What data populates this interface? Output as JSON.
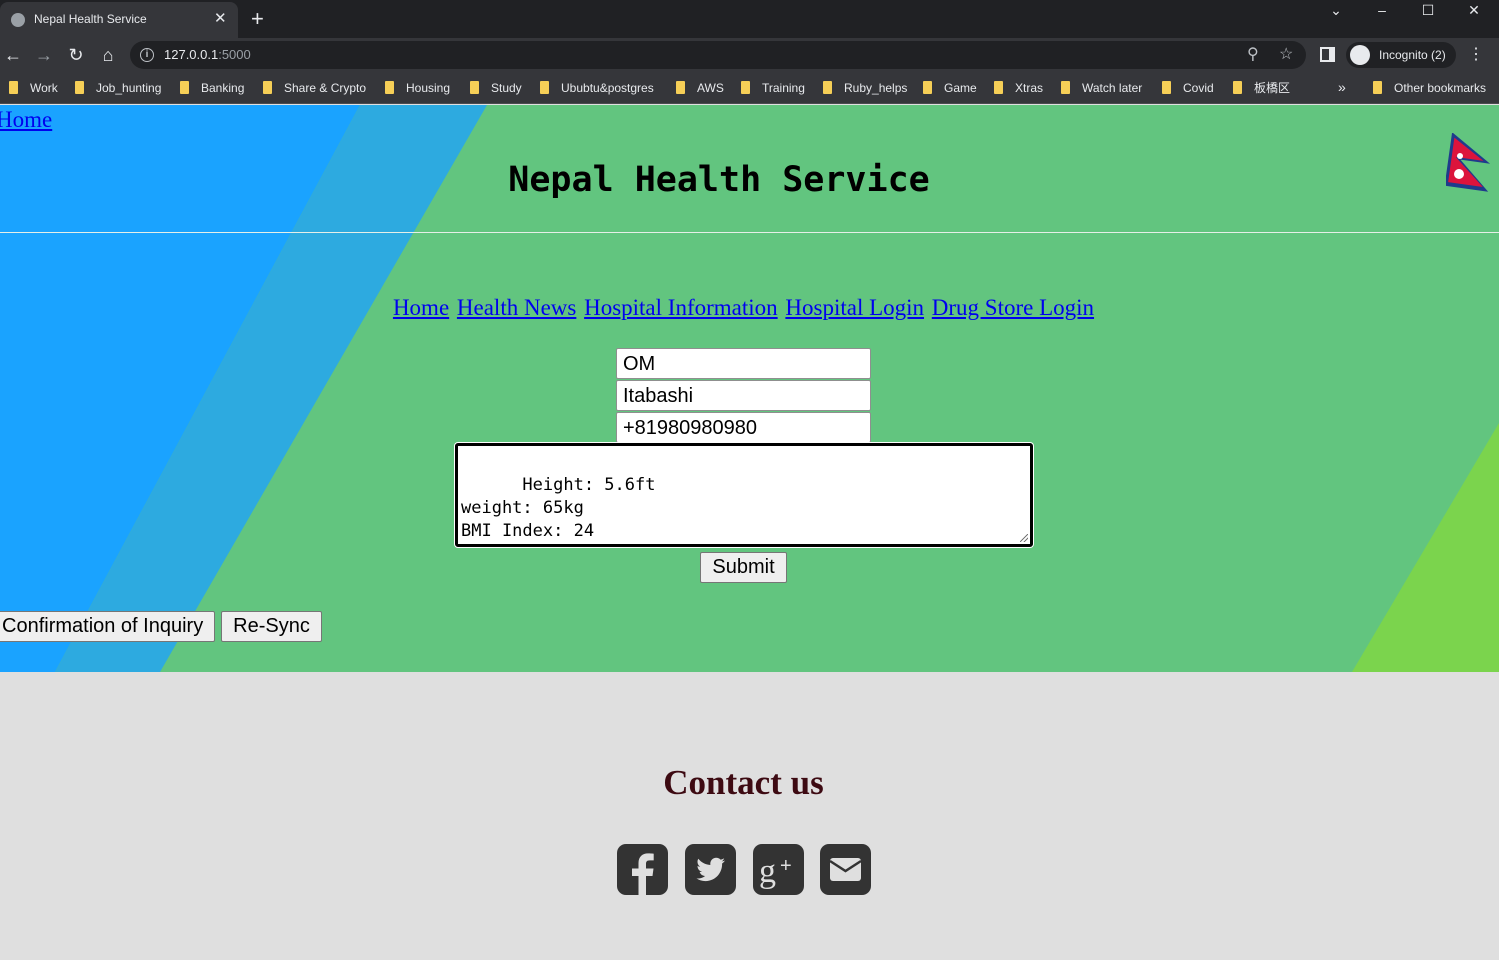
{
  "browser": {
    "tab_title": "Nepal Health Service",
    "tab_close": "✕",
    "new_tab": "+",
    "url_host": "127.0.0.1",
    "url_port": ":5000",
    "profile_label": "Incognito (2)",
    "bookmarks": [
      "Work",
      "Job_hunting",
      "Banking",
      "Share & Crypto",
      "Housing",
      "Study",
      "Ububtu&postgres",
      "AWS",
      "Training",
      "Ruby_helps",
      "Game",
      "Xtras",
      "Watch later",
      "Covid",
      "板橋区"
    ],
    "bookmarks_overflow": "»",
    "other_bookmarks": "Other bookmarks"
  },
  "header": {
    "home_link": "Home",
    "title": "Nepal Health Service"
  },
  "nav": {
    "links": [
      "Home",
      "Health News",
      "Hospital Information",
      "Hospital Login",
      "Drug Store Login"
    ]
  },
  "form": {
    "name_value": "OM",
    "address_value": "Itabashi",
    "phone_value": "+81980980980",
    "details_value": "Height: 5.6ft\nweight: 65kg\nBMI Index: 24",
    "submit_label": "Submit"
  },
  "actions": {
    "confirm_label": "Confirmation of Inquiry",
    "resync_label": "Re-Sync"
  },
  "contact": {
    "title": "Contact us",
    "icons": [
      "facebook-icon",
      "twitter-icon",
      "google-plus-icon",
      "envelope-icon"
    ]
  },
  "colors": {
    "hero_green": "#62c57f",
    "hero_blue": "#1aa3ff",
    "hero_lime": "#7bd44d",
    "link_blue": "#0000ee",
    "contact_title": "#3d0a12",
    "footer_bg": "#dfdfdf"
  }
}
